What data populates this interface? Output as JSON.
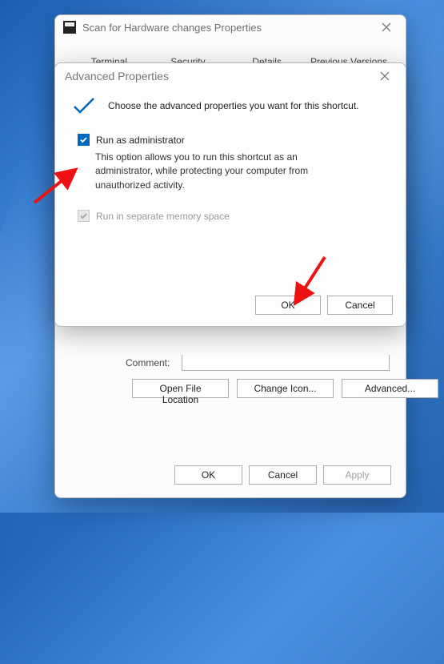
{
  "props": {
    "title": "Scan for Hardware changes Properties",
    "tabs": [
      "Terminal",
      "Security",
      "Details",
      "Previous Versions"
    ],
    "commentLabel": "Comment:",
    "buttons": {
      "openLoc": "Open File Location",
      "changeIcon": "Change Icon...",
      "advanced": "Advanced..."
    },
    "bottom": {
      "ok": "OK",
      "cancel": "Cancel",
      "apply": "Apply"
    }
  },
  "adv": {
    "title": "Advanced Properties",
    "header": "Choose the advanced properties you want for this shortcut.",
    "opt1": {
      "label": "Run as administrator",
      "desc": "This option allows you to run this shortcut as an administrator, while protecting your computer from unauthorized activity."
    },
    "opt2": {
      "label": "Run in separate memory space"
    },
    "ok": "OK",
    "cancel": "Cancel"
  }
}
